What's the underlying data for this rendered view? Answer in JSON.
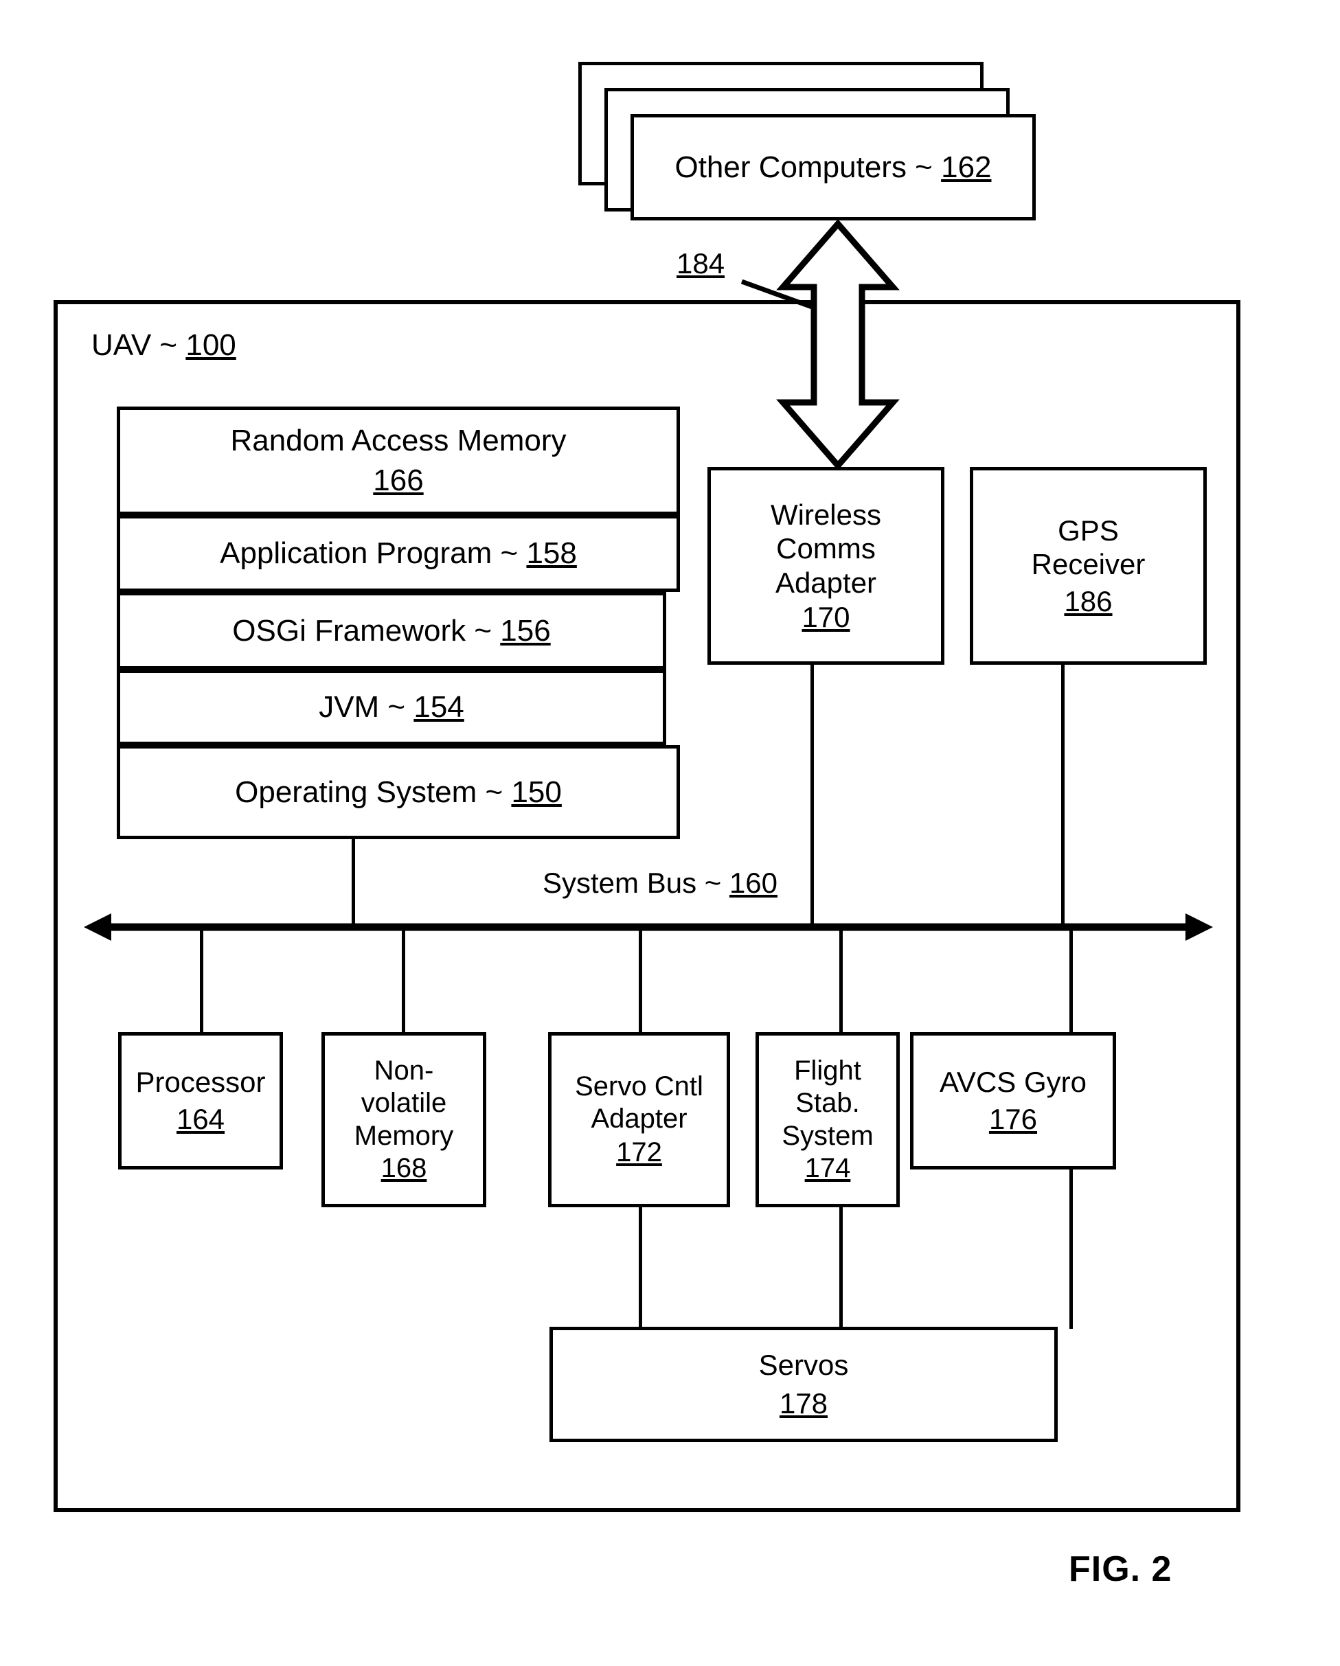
{
  "figure": {
    "label": "FIG. 2"
  },
  "top": {
    "other_computers": {
      "text": "Other Computers ~ ",
      "ref": "162"
    }
  },
  "link": {
    "ref": "184"
  },
  "uav": {
    "title_text": "UAV ~ ",
    "title_ref": "100"
  },
  "memory_stack": [
    {
      "name": "memory-ram",
      "line1": "Random Access Memory",
      "line2": "166",
      "ref_underlined": true,
      "two_line": true
    },
    {
      "name": "memory-application",
      "line1": "Application Program ~ ",
      "ref": "158"
    },
    {
      "name": "memory-osgi",
      "line1": "OSGi Framework ~ ",
      "ref": "156"
    },
    {
      "name": "memory-jvm",
      "line1": "JVM ~ ",
      "ref": "154"
    },
    {
      "name": "memory-os",
      "line1": "Operating System ~ ",
      "ref": "150"
    }
  ],
  "adapters": {
    "wireless": {
      "l1": "Wireless",
      "l2": "Comms",
      "l3": "Adapter",
      "ref": "170"
    },
    "gps": {
      "l1": "GPS",
      "l2": "Receiver",
      "ref": "186"
    }
  },
  "bus": {
    "text": "System Bus ~ ",
    "ref": "160"
  },
  "devices": {
    "processor": {
      "l1": "Processor",
      "ref": "164"
    },
    "nonvolatile": {
      "l1": "Non-",
      "l2": "volatile",
      "l3": "Memory",
      "ref": "168"
    },
    "servo_adapter": {
      "l1": "Servo Cntl",
      "l2": "Adapter",
      "ref": "172"
    },
    "flight_stab": {
      "l1": "Flight",
      "l2": "Stab.",
      "l3": "System",
      "ref": "174"
    },
    "avcs_gyro": {
      "l1": "AVCS Gyro",
      "ref": "176"
    },
    "servos": {
      "l1": "Servos",
      "ref": "178"
    }
  },
  "colors": {
    "ink": "#000000",
    "paper": "#ffffff"
  }
}
